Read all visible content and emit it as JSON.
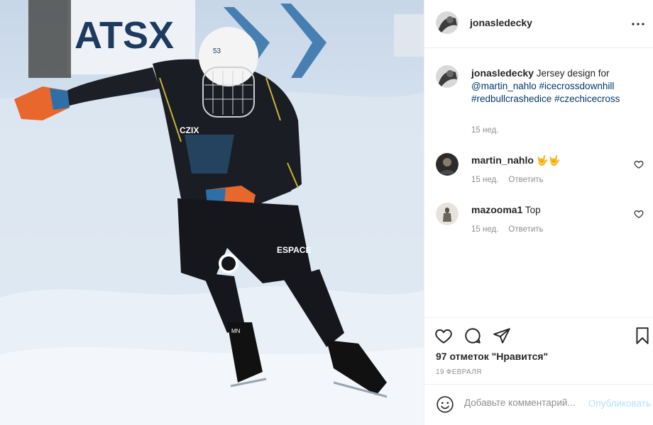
{
  "photo": {
    "banner_text": "ATSX",
    "jersey_brand": "CZIX",
    "helmet_number": "53",
    "shorts_brand": "ESPACE",
    "skate_initials": "MN"
  },
  "post": {
    "author": "jonasledecky",
    "caption": "Jersey design for",
    "mention": "@martin_nahlo",
    "hashtags": [
      "#icecrossdownhill",
      "#redbullcrashedice",
      "#czechicecross"
    ],
    "caption_time": "15 нед."
  },
  "comments": [
    {
      "user": "martin_nahlo",
      "text": "🤟🤟",
      "time": "15 нед.",
      "reply": "Ответить"
    },
    {
      "user": "mazooma1",
      "text": "Top",
      "time": "15 нед.",
      "reply": "Ответить"
    }
  ],
  "actions": {
    "likes": "97 отметок \"Нравится\"",
    "date": "19 ФЕВРАЛЯ"
  },
  "add_comment": {
    "placeholder": "Добавьте комментарий...",
    "publish": "Опубликовать"
  },
  "colors": {
    "link": "#00376b",
    "muted": "#8e8e8e",
    "publish_disabled": "#b2dffc"
  }
}
